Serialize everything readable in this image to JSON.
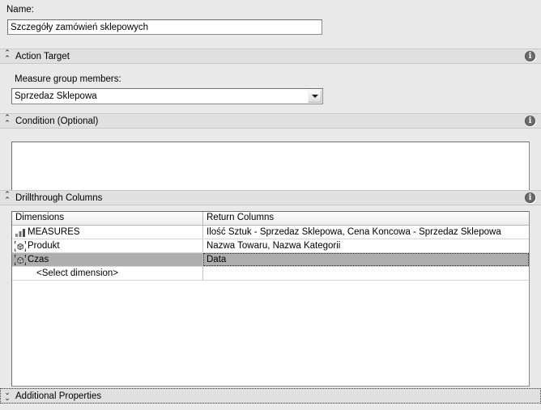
{
  "form": {
    "name_label": "Name:",
    "name_value": "Szczegóły zamówień sklepowych"
  },
  "action_target": {
    "title": "Action Target",
    "members_label": "Measure group members:",
    "selected_member": "Sprzedaz Sklepowa",
    "expanded": true,
    "info_icon": "info-icon",
    "chevron_icon": "chevron-double-up-icon"
  },
  "condition": {
    "title": "Condition (Optional)",
    "value": "",
    "expanded": true,
    "info_icon": "info-icon",
    "chevron_icon": "chevron-double-up-icon"
  },
  "drillthrough": {
    "title": "Drillthrough Columns",
    "expanded": true,
    "info_icon": "info-icon",
    "chevron_icon": "chevron-double-up-icon",
    "columns": [
      "Dimensions",
      "Return Columns"
    ],
    "rows": [
      {
        "icon": "measures-bar-chart-icon",
        "dimension": "MEASURES",
        "return_columns": "Ilość Sztuk - Sprzedaz Sklepowa, Cena Koncowa - Sprzedaz Sklepowa",
        "selected": false
      },
      {
        "icon": "dimension-cube-icon",
        "dimension": "Produkt",
        "return_columns": "Nazwa Towaru, Nazwa Kategorii",
        "selected": false
      },
      {
        "icon": "dimension-cube-icon",
        "dimension": "Czas",
        "return_columns": "Data",
        "selected": true
      },
      {
        "icon": "none",
        "dimension": "<Select dimension>",
        "return_columns": "",
        "selected": false
      }
    ]
  },
  "additional_properties": {
    "title": "Additional Properties",
    "expanded": false,
    "chevron_icon": "chevron-double-down-icon"
  },
  "colors": {
    "background": "#e9e9e9",
    "section_band": "#e0e0e0",
    "selection": "#aeaeae",
    "field_border": "#8a8a8a",
    "info_icon": "#6a6a6a"
  }
}
